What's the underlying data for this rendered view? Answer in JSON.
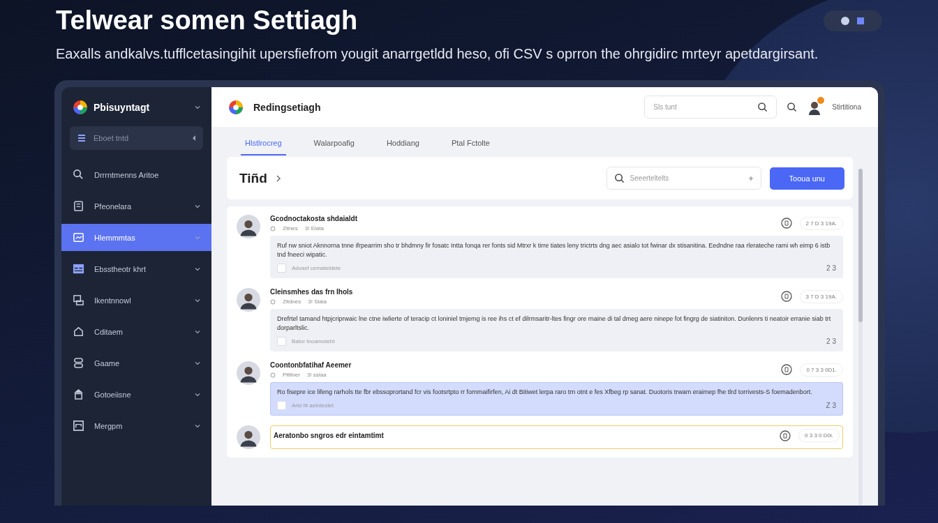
{
  "hero": {
    "title": "Telwear somen Settiagh",
    "description": "Eaxalls andkalvs.tufflcetasingihit upersfiefrom yougit anarrgetldd heso, ofi CSV s oprron the ohrgidirc mrteyr apetdargirsant."
  },
  "sidebar": {
    "app_name": "Pbisuyntagt",
    "search": {
      "placeholder": "Eboet tntd"
    },
    "items": [
      {
        "label": "Drrrntmenns Aritoe",
        "expandable": false,
        "selected": false
      },
      {
        "label": "Pfeonelara",
        "expandable": true,
        "selected": false
      },
      {
        "label": "Hlemmmtas",
        "expandable": true,
        "selected": true
      },
      {
        "label": "Ebsstheotr khrt",
        "expandable": true,
        "selected": false
      },
      {
        "label": "Ikentnnowl",
        "expandable": true,
        "selected": false
      },
      {
        "label": "Cditaem",
        "expandable": true,
        "selected": false
      },
      {
        "label": "Gaame",
        "expandable": true,
        "selected": false
      },
      {
        "label": "Gotoeiisne",
        "expandable": true,
        "selected": false
      },
      {
        "label": "Mergpm",
        "expandable": true,
        "selected": false
      }
    ]
  },
  "header": {
    "app_name": "Redingsetiagh",
    "search": {
      "placeholder": "Sls tunt"
    },
    "user_name": "Stirtitiona"
  },
  "tabs": [
    {
      "label": "Hlstlrocreg",
      "selected": true
    },
    {
      "label": "Walarpoafig",
      "selected": false
    },
    {
      "label": "Hoddiang",
      "selected": false
    },
    {
      "label": "Ptal Fctolte",
      "selected": false
    }
  ],
  "toolbar": {
    "title": "Tiñd",
    "search": {
      "placeholder": "Seeerteltelts"
    },
    "button": "Tooua unu"
  },
  "comments": [
    {
      "name": "Gcodnoctakosta shdaialdt",
      "meta_1": "Zitnes",
      "meta_2": "3! Eiata",
      "time": "2 7 D 3 19A.",
      "body": "Ruf nw sniot Aknnorna tnne ifrpearrim sho tr bhdmny fir fosatc Intta fonqa rer fonts sid Mtrxr k tirre tiates leny trictrts dng aec asialo tot fwinar dx stisanitina. Eedndne raa rlerateche rami wh eimp 6 istb tnd fneeci wipatic.",
      "note": "Advaxf cemateldete",
      "count": "2 3",
      "checked": false,
      "selected": false,
      "flagged": false
    },
    {
      "name": "Cleinsmhes das frn Ihols",
      "meta_1": "Zitdnes",
      "meta_2": "3! Siaia",
      "time": "3 7 D 3 19A.",
      "body": "Drefrtel tamand htpjcriprwaic lne ctne iwlierte of teracip ct loniniel tmjemg is ree ihs ct ef dilrmsaritr-ltes fingr ore rnaine di tal dmeg aere ninepe fot fingrg de siatiniton. Dunlenrs ti neatoir erranie siab trt dorparltslic.",
      "note": "Bator tnoamotebt",
      "count": "2 3",
      "checked": false,
      "selected": false,
      "flagged": false
    },
    {
      "name": "Coontonbfatihaf Aeemer",
      "meta_1": "Pititner",
      "meta_2": "3! ssiaa",
      "time": "0 7 3 3 0D1.",
      "body": "Ro fisepre ice lifeng rarhols tte fbr ebssoprortand fcr vis footsrtpto rr fornmaifirfen, Ai dt Bitiwet lerpa raro trn otnt e fes Xfbeg rp sanat. Duotoris trwam eraimep fhe tlrd torrivests-S foemadenbort.",
      "note": "Arkt f# aeintestet",
      "count": "Z 3",
      "checked": false,
      "selected": true,
      "flagged": false
    },
    {
      "name": "Aeratonbo sngros edr eintamtimt",
      "time": "0 3 3 0 D0l.",
      "flagged": true
    }
  ]
}
